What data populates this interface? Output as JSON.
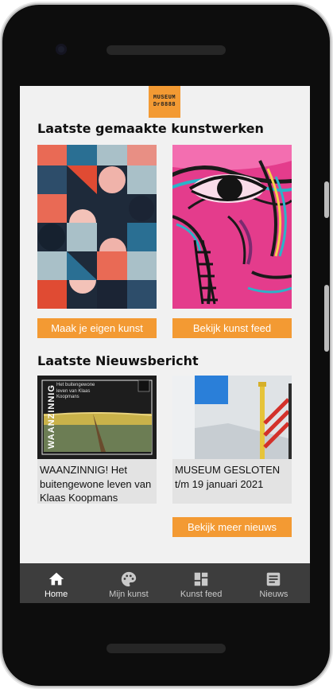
{
  "logo": {
    "line1": "MUSEUM",
    "line2": "Dr8888"
  },
  "section_artworks": {
    "title": "Laatste gemaakte kunstwerken",
    "buttons": {
      "make_art": "Maak je eigen kunst",
      "view_feed": "Bekijk kunst feed"
    }
  },
  "section_news": {
    "title": "Laatste Nieuwsbericht",
    "items": [
      {
        "title": "WAANZINNIG! Het buitengewone leven van Klaas Koopmans",
        "poster_title": "WAANZINNIG",
        "poster_sub": "Het buitengewone leven van Klaas Koopmans"
      },
      {
        "title": "MUSEUM GESLOTEN t/m 19 januari 2021"
      }
    ],
    "more_button": "Bekijk meer nieuws"
  },
  "nav": {
    "items": [
      {
        "label": "Home",
        "icon": "home-icon",
        "active": true
      },
      {
        "label": "Mijn kunst",
        "icon": "palette-icon",
        "active": false
      },
      {
        "label": "Kunst feed",
        "icon": "dashboard-icon",
        "active": false
      },
      {
        "label": "Nieuws",
        "icon": "newspaper-icon",
        "active": false
      }
    ]
  },
  "colors": {
    "accent": "#f39a33",
    "nav_bg": "#3d3d3d",
    "nav_active": "#ffffff",
    "nav_inactive": "#c9c9c9"
  }
}
